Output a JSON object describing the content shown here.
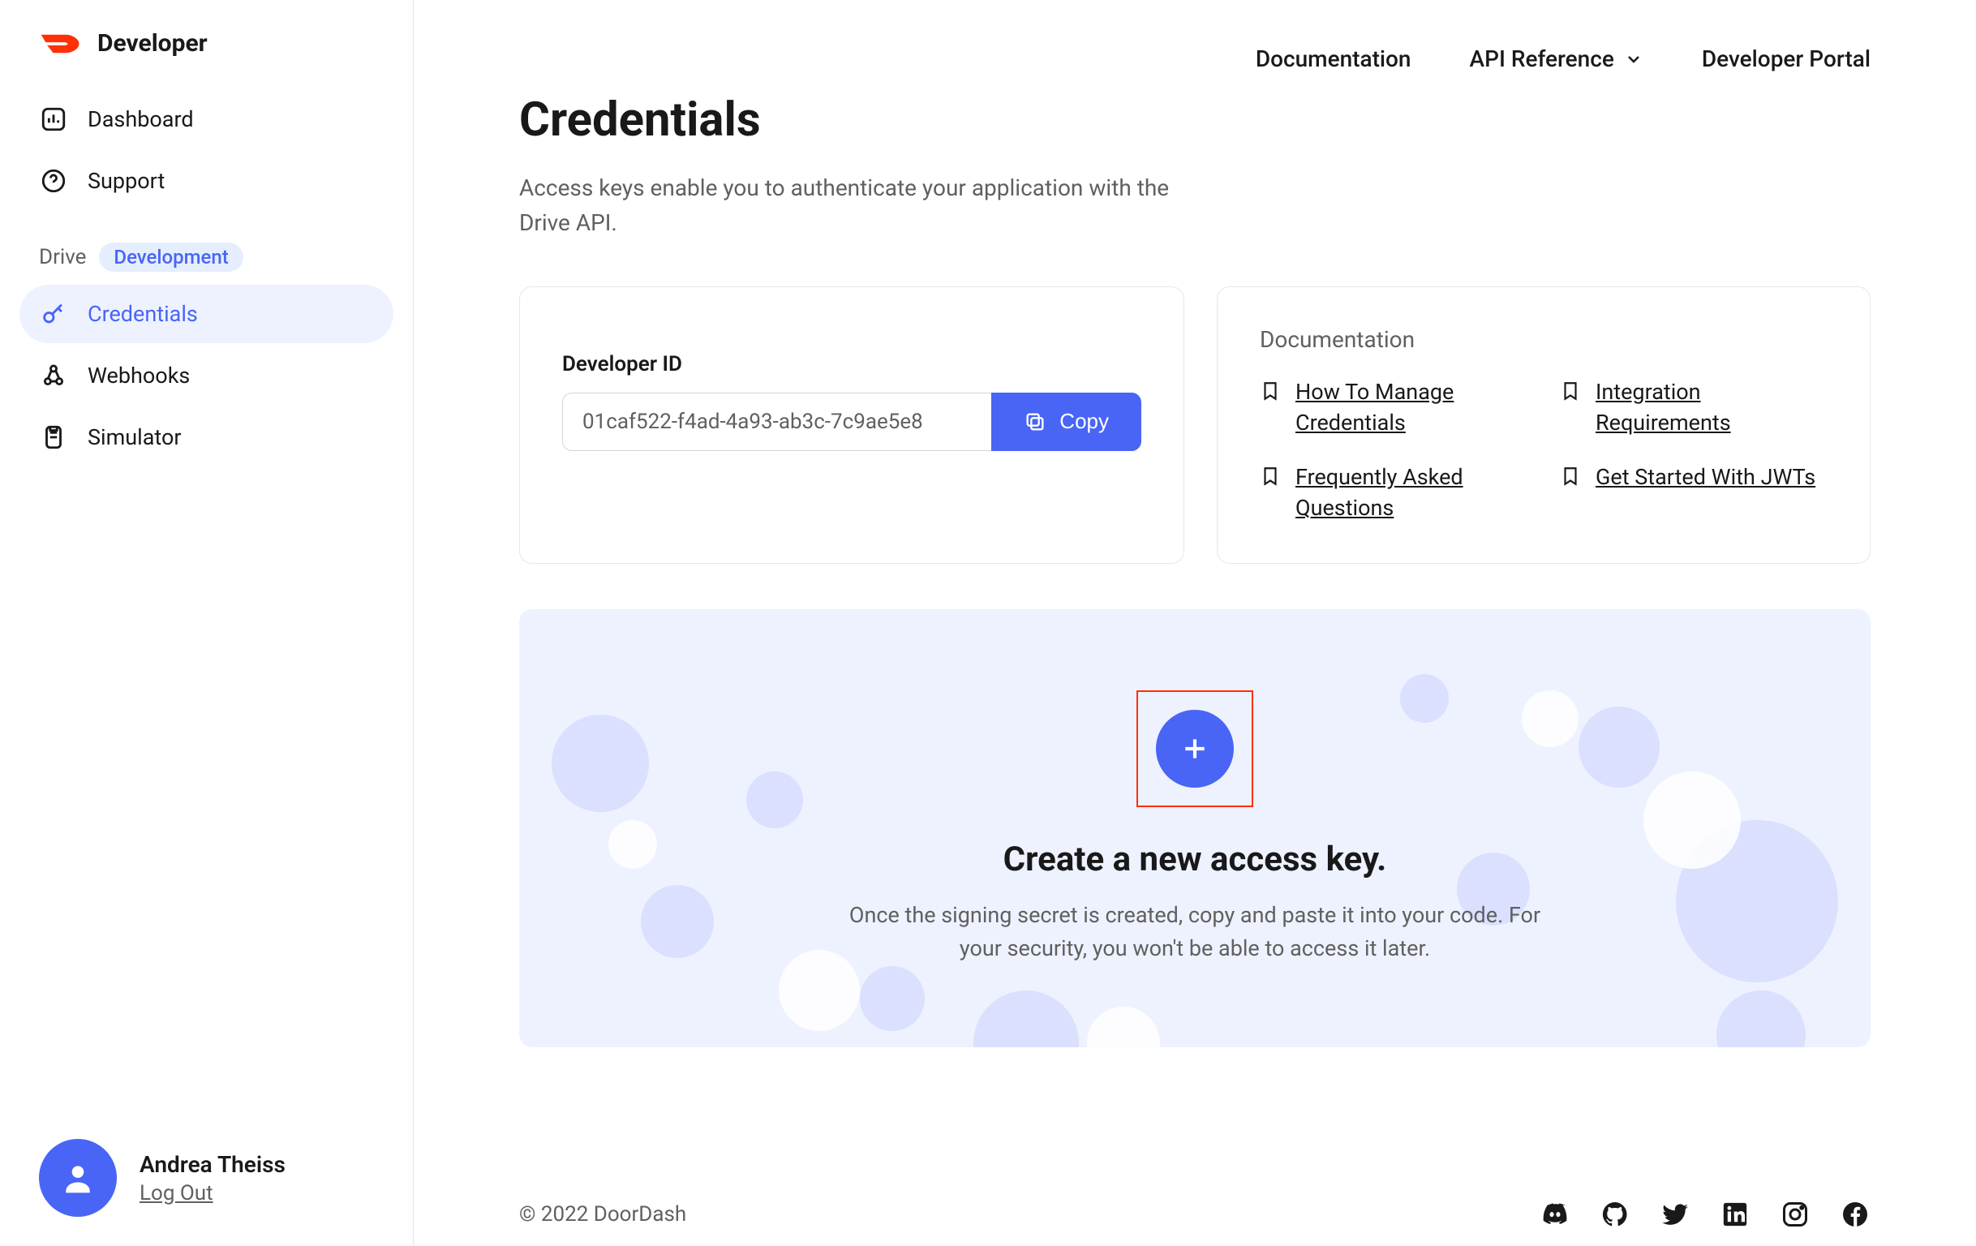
{
  "brand": {
    "name": "Developer"
  },
  "topnav": {
    "documentation": "Documentation",
    "api_reference": "API Reference",
    "developer_portal": "Developer Portal"
  },
  "sidebar": {
    "primary": [
      {
        "label": "Dashboard"
      },
      {
        "label": "Support"
      }
    ],
    "section_label": "Drive",
    "section_badge": "Development",
    "sub": [
      {
        "label": "Credentials"
      },
      {
        "label": "Webhooks"
      },
      {
        "label": "Simulator"
      }
    ]
  },
  "user": {
    "name": "Andrea Theiss",
    "logout": "Log Out"
  },
  "page": {
    "title": "Credentials",
    "subtitle": "Access keys enable you to authenticate your application with the Drive API."
  },
  "devid_card": {
    "label": "Developer ID",
    "value": "01caf522-f4ad-4a93-ab3c-7c9ae5e8",
    "copy": "Copy"
  },
  "doc_card": {
    "title": "Documentation",
    "links": [
      "How To Manage Credentials",
      "Integration Requirements",
      "Frequently Asked Questions",
      "Get Started With JWTs"
    ]
  },
  "create": {
    "title": "Create a new access key.",
    "subtitle": "Once the signing secret is created, copy and paste it into your code. For your security, you won't be able to access it later."
  },
  "footer": {
    "copyright": "© 2022 DoorDash"
  }
}
